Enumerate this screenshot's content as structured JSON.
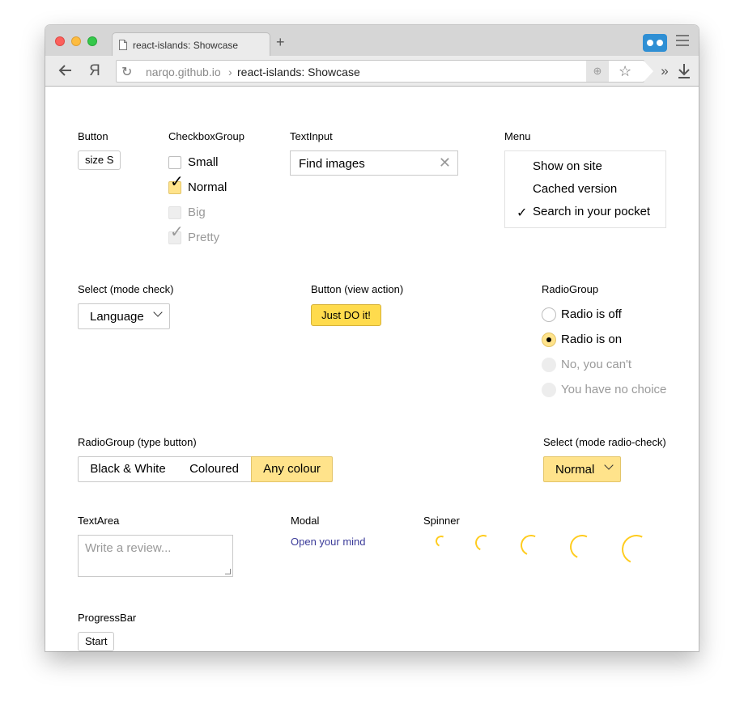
{
  "browser": {
    "tab_title": "react-islands: Showcase",
    "new_tab": "+",
    "yandex_logo": "Я",
    "url_domain": "narqo.github.io",
    "url_separator": "›",
    "url_title": "react-islands: Showcase",
    "more": "»",
    "icons": [
      "page-icon",
      "back-arrow-icon",
      "reload-icon",
      "globe-icon",
      "star-icon",
      "download-icon",
      "menu-icon",
      "cassette-extension-icon"
    ]
  },
  "sections": {
    "button": "Button",
    "checkbox_group": "CheckboxGroup",
    "text_input": "TextInput",
    "menu": "Menu",
    "select_check": "Select (mode check)",
    "button_action": "Button (view action)",
    "radio_group": "RadioGroup",
    "radio_group_button": "RadioGroup (type button)",
    "select_radio_check": "Select (mode radio-check)",
    "textarea": "TextArea",
    "modal": "Modal",
    "spinner": "Spinner",
    "progressbar": "ProgressBar"
  },
  "button_size_s": "size S",
  "checkboxes": [
    {
      "label": "Small",
      "state": "unchecked"
    },
    {
      "label": "Normal",
      "state": "checked"
    },
    {
      "label": "Big",
      "state": "disabled"
    },
    {
      "label": "Pretty",
      "state": "disabled-checked"
    }
  ],
  "check_mark": "✓",
  "text_input": {
    "value": "Find images",
    "clear": "✕"
  },
  "menu_items": [
    {
      "label": "Show on site",
      "checked": false
    },
    {
      "label": "Cached version",
      "checked": false
    },
    {
      "label": "Search in your pocket",
      "checked": true
    }
  ],
  "select_check_label": "Language",
  "action_button": "Just DO it!",
  "radios": [
    {
      "label": "Radio is off",
      "state": "off"
    },
    {
      "label": "Radio is on",
      "state": "on"
    },
    {
      "label": "No, you can't",
      "state": "disabled"
    },
    {
      "label": "You have no choice",
      "state": "disabled"
    }
  ],
  "segmented": [
    {
      "label": "Black & White",
      "active": false
    },
    {
      "label": "Coloured",
      "active": false
    },
    {
      "label": "Any colour",
      "active": true
    }
  ],
  "select_radio_label": "Normal",
  "textarea_placeholder": "Write a review...",
  "modal_link": "Open your mind",
  "progress_start": "Start",
  "colors": {
    "accent_yellow": "#ffdb4d",
    "selected_yellow": "#ffe38b",
    "spinner": "#ffcc1f",
    "link": "#3b3b99"
  }
}
